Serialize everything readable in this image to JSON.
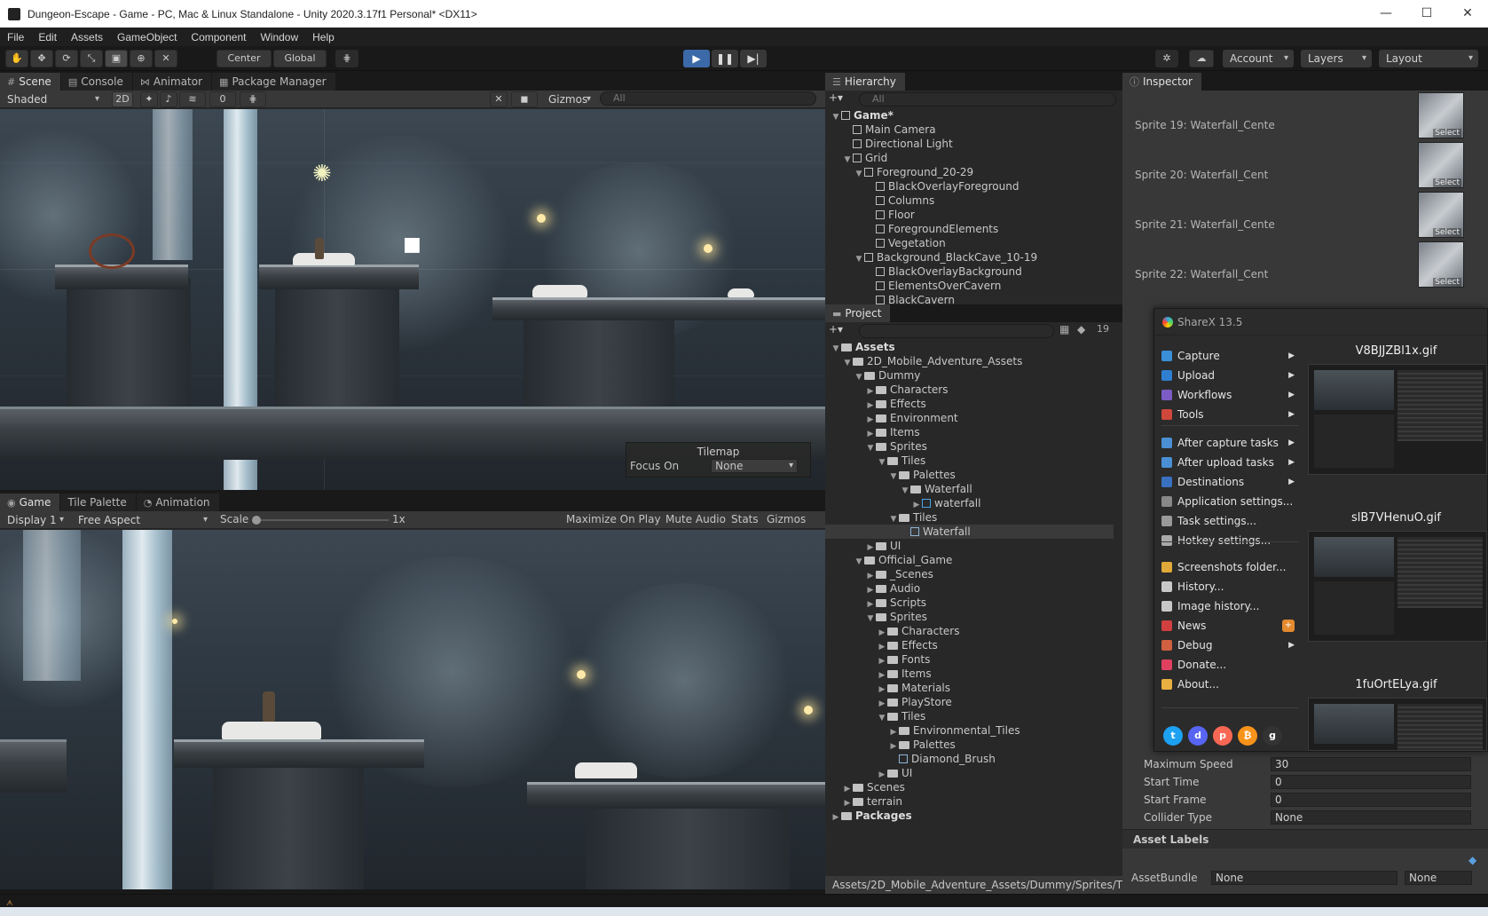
{
  "window": {
    "title": "Dungeon-Escape - Game - PC, Mac & Linux Standalone - Unity 2020.3.17f1 Personal* <DX11>",
    "minimize": "—",
    "maximize": "☐",
    "close": "✕"
  },
  "menu": [
    "File",
    "Edit",
    "Assets",
    "GameObject",
    "Component",
    "Window",
    "Help"
  ],
  "toolbar": {
    "pivot": "Center",
    "space": "Global",
    "account": "Account",
    "layers": "Layers",
    "layout": "Layout",
    "play_icon": "▶",
    "pause_icon": "❚❚",
    "step_icon": "▶|"
  },
  "scene_panel": {
    "tabs": [
      "Scene",
      "Console",
      "Animator",
      "Package Manager"
    ],
    "shading": "Shaded",
    "mode2d": "2D",
    "hidden_count": "0",
    "gizmos": "Gizmos",
    "search_placeholder": "All",
    "tilemap_overlay": {
      "title": "Tilemap",
      "focus_label": "Focus On",
      "focus_value": "None"
    }
  },
  "game_panel": {
    "tabs": [
      "Game",
      "Tile Palette",
      "Animation"
    ],
    "display": "Display 1",
    "aspect": "Free Aspect",
    "scale_label": "Scale",
    "scale_value": "1x",
    "maximize": "Maximize On Play",
    "mute": "Mute Audio",
    "stats": "Stats",
    "gizmos": "Gizmos"
  },
  "hierarchy": {
    "tab": "Hierarchy",
    "search_placeholder": "All",
    "items": [
      {
        "label": "Game*",
        "depth": 0,
        "arrow": "▼",
        "bold": true
      },
      {
        "label": "Main Camera",
        "depth": 1,
        "arrow": ""
      },
      {
        "label": "Directional Light",
        "depth": 1,
        "arrow": ""
      },
      {
        "label": "Grid",
        "depth": 1,
        "arrow": "▼"
      },
      {
        "label": "Foreground_20-29",
        "depth": 2,
        "arrow": "▼"
      },
      {
        "label": "BlackOverlayForeground",
        "depth": 3,
        "arrow": ""
      },
      {
        "label": "Columns",
        "depth": 3,
        "arrow": ""
      },
      {
        "label": "Floor",
        "depth": 3,
        "arrow": ""
      },
      {
        "label": "ForegroundElements",
        "depth": 3,
        "arrow": ""
      },
      {
        "label": "Vegetation",
        "depth": 3,
        "arrow": ""
      },
      {
        "label": "Background_BlackCave_10-19",
        "depth": 2,
        "arrow": "▼"
      },
      {
        "label": "BlackOverlayBackground",
        "depth": 3,
        "arrow": ""
      },
      {
        "label": "ElementsOverCavern",
        "depth": 3,
        "arrow": ""
      },
      {
        "label": "BlackCavern",
        "depth": 3,
        "arrow": ""
      }
    ]
  },
  "project": {
    "tab": "Project",
    "hidden_count": "19",
    "path": "Assets/2D_Mobile_Adventure_Assets/Dummy/Sprites/Til",
    "items": [
      {
        "label": "Assets",
        "depth": 0,
        "arrow": "▼",
        "bold": true
      },
      {
        "label": "2D_Mobile_Adventure_Assets",
        "depth": 1,
        "arrow": "▼"
      },
      {
        "label": "Dummy",
        "depth": 2,
        "arrow": "▼"
      },
      {
        "label": "Characters",
        "depth": 3,
        "arrow": "▶"
      },
      {
        "label": "Effects",
        "depth": 3,
        "arrow": "▶"
      },
      {
        "label": "Environment",
        "depth": 3,
        "arrow": "▶"
      },
      {
        "label": "Items",
        "depth": 3,
        "arrow": "▶"
      },
      {
        "label": "Sprites",
        "depth": 3,
        "arrow": "▼"
      },
      {
        "label": "Tiles",
        "depth": 4,
        "arrow": "▼"
      },
      {
        "label": "Palettes",
        "depth": 5,
        "arrow": "▼"
      },
      {
        "label": "Waterfall",
        "depth": 6,
        "arrow": "▼"
      },
      {
        "label": "waterfall",
        "depth": 7,
        "arrow": "▶",
        "icon": "prefab"
      },
      {
        "label": "Tiles",
        "depth": 5,
        "arrow": "▼"
      },
      {
        "label": "Waterfall",
        "depth": 6,
        "arrow": "",
        "icon": "tile",
        "selected": true
      },
      {
        "label": "UI",
        "depth": 3,
        "arrow": "▶"
      },
      {
        "label": "Official_Game",
        "depth": 2,
        "arrow": "▼"
      },
      {
        "label": "_Scenes",
        "depth": 3,
        "arrow": "▶"
      },
      {
        "label": "Audio",
        "depth": 3,
        "arrow": "▶"
      },
      {
        "label": "Scripts",
        "depth": 3,
        "arrow": "▶"
      },
      {
        "label": "Sprites",
        "depth": 3,
        "arrow": "▼"
      },
      {
        "label": "Characters",
        "depth": 4,
        "arrow": "▶"
      },
      {
        "label": "Effects",
        "depth": 4,
        "arrow": "▶"
      },
      {
        "label": "Fonts",
        "depth": 4,
        "arrow": "▶"
      },
      {
        "label": "Items",
        "depth": 4,
        "arrow": "▶"
      },
      {
        "label": "Materials",
        "depth": 4,
        "arrow": "▶"
      },
      {
        "label": "PlayStore",
        "depth": 4,
        "arrow": "▶"
      },
      {
        "label": "Tiles",
        "depth": 4,
        "arrow": "▼"
      },
      {
        "label": "Environmental_Tiles",
        "depth": 5,
        "arrow": "▶"
      },
      {
        "label": "Palettes",
        "depth": 5,
        "arrow": "▶"
      },
      {
        "label": "Diamond_Brush",
        "depth": 5,
        "arrow": "",
        "icon": "tile"
      },
      {
        "label": "UI",
        "depth": 4,
        "arrow": "▶"
      },
      {
        "label": "Scenes",
        "depth": 1,
        "arrow": "▶"
      },
      {
        "label": "terrain",
        "depth": 1,
        "arrow": "▶"
      },
      {
        "label": "Packages",
        "depth": 0,
        "arrow": "▶",
        "bold": true
      }
    ]
  },
  "inspector": {
    "tab": "Inspector",
    "sprites": [
      {
        "label": "Sprite 19: Waterfall_Cente",
        "thumb": "Select"
      },
      {
        "label": "Sprite 20: Waterfall_Cent",
        "thumb": "Select"
      },
      {
        "label": "Sprite 21: Waterfall_Cente",
        "thumb": "Select"
      },
      {
        "label": "Sprite 22: Waterfall_Cent",
        "thumb": "Select"
      }
    ],
    "props": [
      {
        "label": "Maximum Speed",
        "value": "30"
      },
      {
        "label": "Start Time",
        "value": "0"
      },
      {
        "label": "Start Frame",
        "value": "0"
      },
      {
        "label": "Collider Type",
        "value": "None"
      }
    ],
    "asset_labels": "Asset Labels",
    "asset_bundle_label": "AssetBundle",
    "asset_bundle_value": "None",
    "asset_bundle_variant": "None"
  },
  "sharex": {
    "title": "ShareX 13.5",
    "items": [
      {
        "label": "Capture",
        "sub": true,
        "color": "#3a8fd6"
      },
      {
        "label": "Upload",
        "sub": true,
        "color": "#2f7fd1"
      },
      {
        "label": "Workflows",
        "sub": true,
        "color": "#7c5cc4"
      },
      {
        "label": "Tools",
        "sub": true,
        "color": "#d0473b"
      },
      {
        "label": "After capture tasks",
        "sub": true,
        "color": "#4a8fd4"
      },
      {
        "label": "After upload tasks",
        "sub": true,
        "color": "#4a8fd4"
      },
      {
        "label": "Destinations",
        "sub": true,
        "color": "#3a70c0"
      },
      {
        "label": "Application settings...",
        "sub": false,
        "color": "#888888"
      },
      {
        "label": "Task settings...",
        "sub": false,
        "color": "#999999"
      },
      {
        "label": "Hotkey settings...",
        "sub": false,
        "color": "#aaaaaa"
      },
      {
        "label": "Screenshots folder...",
        "sub": false,
        "color": "#e0a93a"
      },
      {
        "label": "History...",
        "sub": false,
        "color": "#c8c8c8"
      },
      {
        "label": "Image history...",
        "sub": false,
        "color": "#c8c8c8"
      },
      {
        "label": "News",
        "sub": false,
        "color": "#d04040",
        "badge": "+"
      },
      {
        "label": "Debug",
        "sub": true,
        "color": "#d06040"
      },
      {
        "label": "Donate...",
        "sub": false,
        "color": "#e04060"
      },
      {
        "label": "About...",
        "sub": false,
        "color": "#e8b040"
      }
    ],
    "recent": [
      "V8BJJZBl1x.gif",
      "slB7VHenuO.gif",
      "1fuOrtELya.gif"
    ],
    "social": [
      {
        "name": "twitter-icon",
        "glyph": "t",
        "color": "#1da1f2"
      },
      {
        "name": "discord-icon",
        "glyph": "d",
        "color": "#5865f2"
      },
      {
        "name": "patreon-icon",
        "glyph": "p",
        "color": "#f96854"
      },
      {
        "name": "bitcoin-icon",
        "glyph": "₿",
        "color": "#f7931a"
      },
      {
        "name": "github-icon",
        "glyph": "g",
        "color": "#333333"
      }
    ]
  }
}
